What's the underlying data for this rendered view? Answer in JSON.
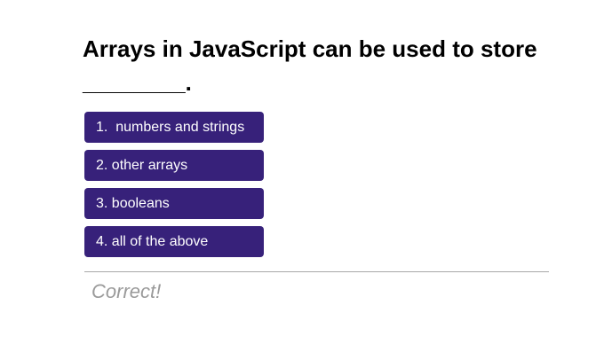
{
  "question": {
    "text": "Arrays in JavaScript can be used to store ________."
  },
  "choices": [
    {
      "label": "1.  numbers and strings"
    },
    {
      "label": "2. other arrays"
    },
    {
      "label": "3. booleans"
    },
    {
      "label": "4. all of the above"
    }
  ],
  "feedback": {
    "text": "Correct!"
  },
  "colors": {
    "button_bg": "#37217a",
    "button_text": "#ffffff",
    "feedback_text": "#9a9a9a",
    "divider": "#a8a8a8"
  }
}
